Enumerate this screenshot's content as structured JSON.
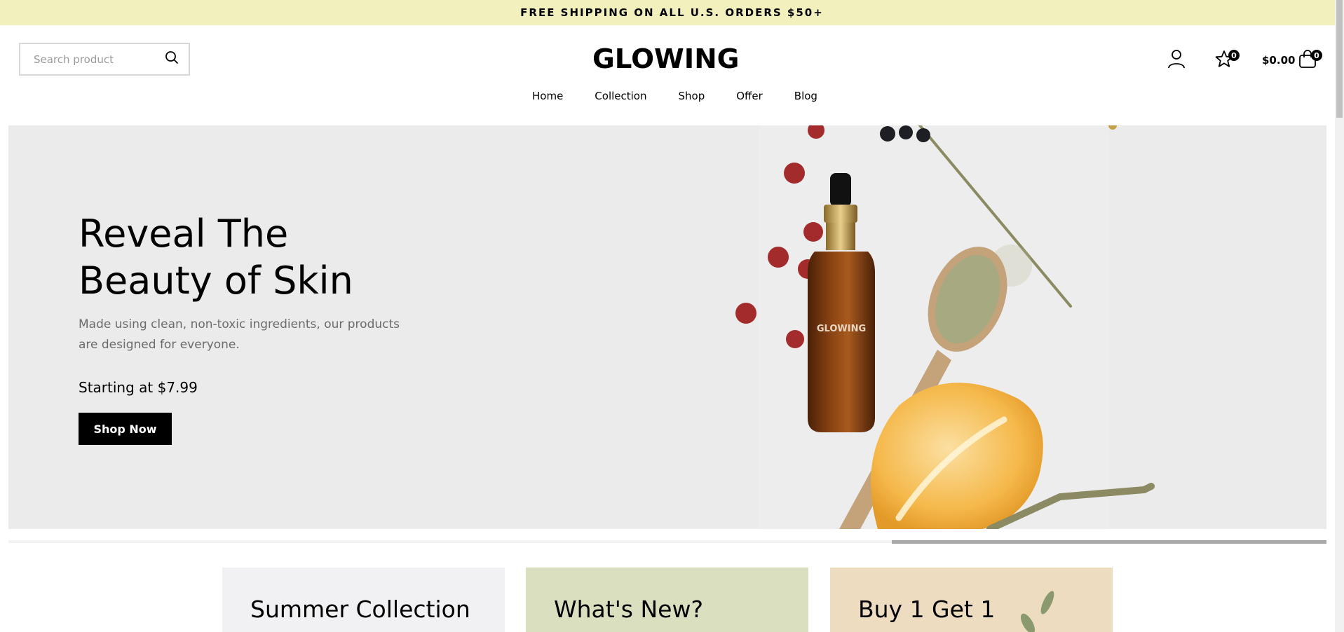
{
  "announcement": "FREE SHIPPING ON ALL U.S. ORDERS $50+",
  "search": {
    "placeholder": "Search product"
  },
  "logo": "GLOWING",
  "nav": [
    "Home",
    "Collection",
    "Shop",
    "Offer",
    "Blog"
  ],
  "wishlist_count": "0",
  "cart": {
    "total": "$0.00",
    "count": "0"
  },
  "hero": {
    "title_line1": "Reveal The",
    "title_line2": "Beauty of Skin",
    "description_line1": "Made using clean, non-toxic ingredients, our products",
    "description_line2": "are designed for everyone.",
    "price": "Starting at $7.99",
    "button": "Shop Now",
    "bottle_label": "GLOWING"
  },
  "slider_progress": 0.33,
  "cards": [
    {
      "title": "Summer Collection",
      "bg": "#f1f1f3"
    },
    {
      "title": "What's New?",
      "bg": "#d9dfbf"
    },
    {
      "title": "Buy 1 Get 1",
      "bg": "#eddcbf"
    }
  ],
  "colors": {
    "announcement_bg": "#f2f1bd",
    "hero_bg": "#ebebeb",
    "button_bg": "#000000"
  }
}
